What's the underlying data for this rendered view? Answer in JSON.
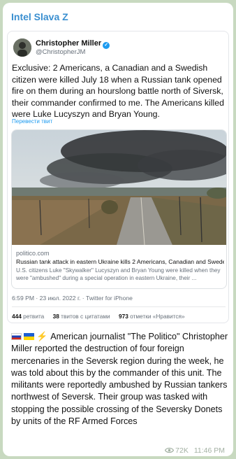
{
  "channel": {
    "name": "Intel Slava Z"
  },
  "tweet": {
    "author_name": "Christopher Miller",
    "author_handle": "@ChristopherJM",
    "text": "Exclusive: 2 Americans, a Canadian and a Swedish citizen were killed July 18 when a Russian tank opened fire on them during an hourslong battle north of Siversk, their commander confirmed to me. The Americans killed were Luke Lucyszyn and Bryan Young.",
    "translate_label": "Перевести твит",
    "card": {
      "domain": "politico.com",
      "title": "Russian tank attack in eastern Ukraine kills 2 Americans, Canadian and Swede",
      "description": "U.S. citizens Luke \"Skywalker\" Lucyszyn and Bryan Young were killed when they were \"ambushed\" during a special operation in eastern Ukraine, their ..."
    },
    "meta": "6:59 PM · 23 июл. 2022 г. · Twitter for iPhone",
    "stats": {
      "retweets": "444",
      "retweets_label": "ретвита",
      "quotes": "38",
      "quotes_label": "твитов с цитатами",
      "likes": "973",
      "likes_label": "отметки «Нравится»"
    }
  },
  "post": {
    "text": "American journalist \"The Politico\" Christopher Miller reported the destruction of four foreign mercenaries in the Seversk region during the week, he was told about this by the commander of this unit.  The militants were reportedly ambushed by Russian tankers northwest of Seversk.  Their group was tasked with stopping the possible crossing of the Seversky Donets by units of the RF Armed Forces",
    "views": "72K",
    "time": "11:46 PM"
  },
  "icons": {
    "flag_1": "russia-flag-icon",
    "flag_2": "ukraine-flag-icon",
    "emoji_3": "lightning-icon",
    "verified": "verified-badge-icon",
    "views": "eye-icon"
  },
  "colors": {
    "channel_name": "#3a8fd0",
    "twitter_link": "#1d9bf0",
    "background": "#c8d9c0"
  }
}
